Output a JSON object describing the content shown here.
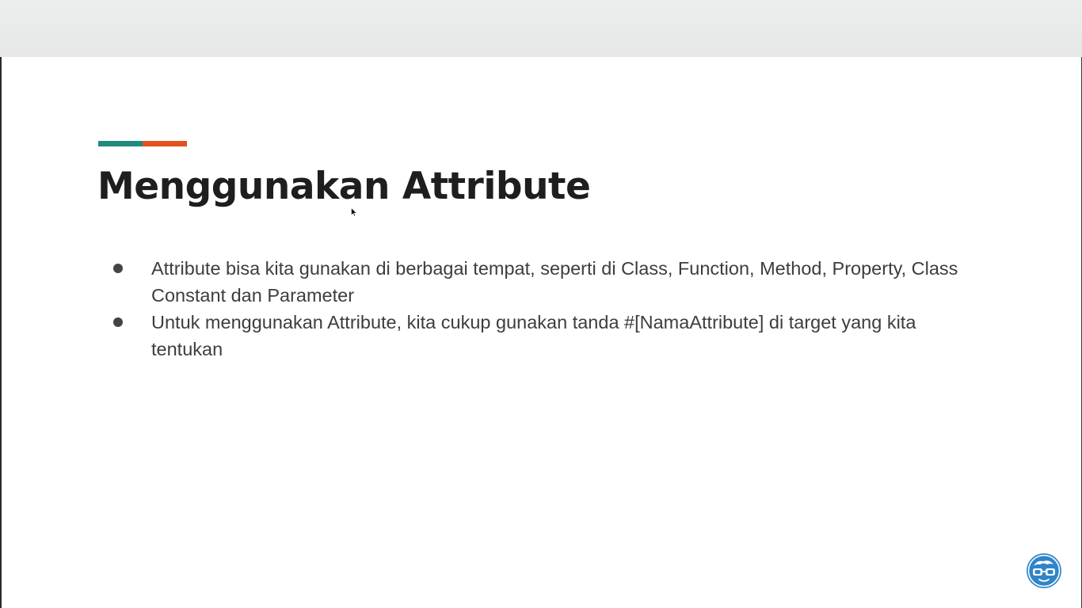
{
  "slide": {
    "title": "Menggunakan Attribute",
    "bullets": [
      "Attribute bisa kita gunakan di berbagai tempat, seperti di Class, Function, Method, Property, Class Constant dan Parameter",
      "Untuk menggunakan Attribute, kita cukup gunakan tanda #[NamaAttribute] di target yang kita tentukan"
    ]
  },
  "colors": {
    "accent_teal": "#1f8a7e",
    "accent_orange": "#e0531e",
    "logo_blue": "#2f85c8"
  },
  "icons": {
    "cursor": "mouse-pointer-icon",
    "logo": "nerd-glasses-logo-icon"
  }
}
